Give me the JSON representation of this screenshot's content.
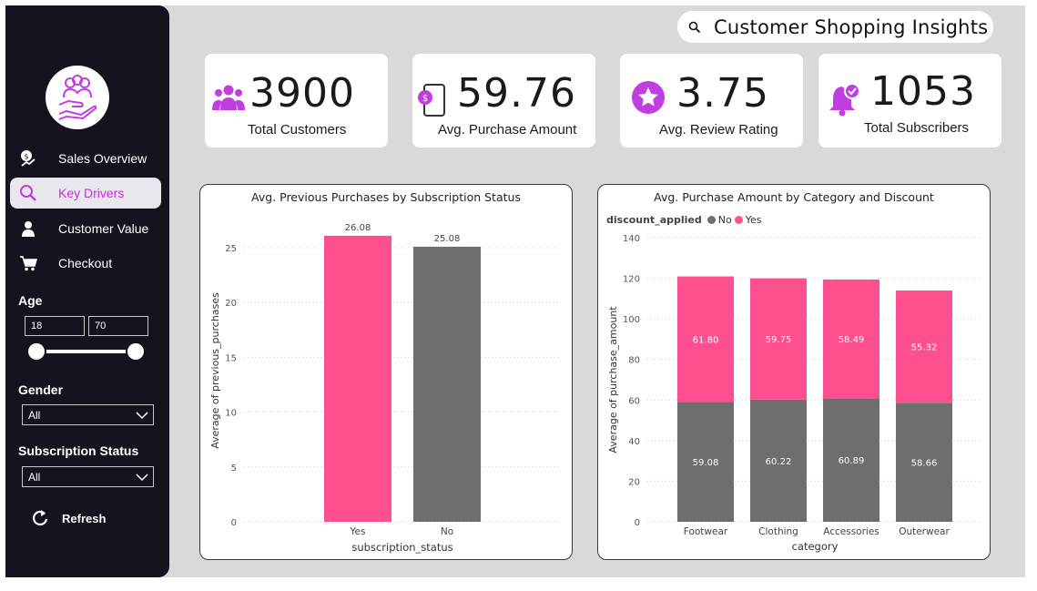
{
  "header": {
    "title": "Customer Shopping Insights"
  },
  "sidebar": {
    "nav": [
      {
        "label": "Sales Overview",
        "icon": "sales-icon",
        "active": false
      },
      {
        "label": "Key Drivers",
        "icon": "magnifier-icon",
        "active": true
      },
      {
        "label": "Customer Value",
        "icon": "person-icon",
        "active": false
      },
      {
        "label": "Checkout",
        "icon": "cart-icon",
        "active": false
      }
    ],
    "age": {
      "label": "Age",
      "min": "18",
      "max": "70"
    },
    "gender": {
      "label": "Gender",
      "value": "All"
    },
    "subscription": {
      "label": "Subscription Status",
      "value": "All"
    },
    "refresh_label": "Refresh"
  },
  "kpis": [
    {
      "value": "3900",
      "label": "Total Customers",
      "icon": "people-icon"
    },
    {
      "value": "59.76",
      "label": "Avg. Purchase Amount",
      "icon": "phone-dollar-icon"
    },
    {
      "value": "3.75",
      "label": "Avg. Review Rating",
      "icon": "star-icon"
    },
    {
      "value": "1053",
      "label": "Total Subscribers",
      "icon": "bell-check-icon"
    }
  ],
  "colors": {
    "accent": "#fe4f8f",
    "gray": "#6e6e6e",
    "icon_purple": "#c03ede",
    "sidebar_bg": "#16131f"
  },
  "chart_data": [
    {
      "type": "bar",
      "title": "Avg. Previous Purchases by Subscription Status",
      "xlabel": "subscription_status",
      "ylabel": "Average of previous_purchases",
      "categories": [
        "Yes",
        "No"
      ],
      "values": [
        26.08,
        25.08
      ],
      "labels": [
        "26.08",
        "25.08"
      ],
      "colors": [
        "#fe4f8f",
        "#6e6e6e"
      ],
      "ylim": [
        0,
        28
      ],
      "yticks": [
        0,
        5,
        10,
        15,
        20,
        25
      ],
      "grid": true
    },
    {
      "type": "bar",
      "stacked": true,
      "title": "Avg. Purchase Amount by Category and Discount",
      "xlabel": "category",
      "ylabel": "Average of purchase_amount",
      "legend_title": "discount_applied",
      "categories": [
        "Footwear",
        "Clothing",
        "Accessories",
        "Outerwear"
      ],
      "series": [
        {
          "name": "No",
          "color": "#6e6e6e",
          "values": [
            59.08,
            60.22,
            60.89,
            58.66
          ],
          "labels": [
            "59.08",
            "60.22",
            "60.89",
            "58.66"
          ]
        },
        {
          "name": "Yes",
          "color": "#fe4f8f",
          "values": [
            61.8,
            59.75,
            58.49,
            55.32
          ],
          "labels": [
            "61.80",
            "59.75",
            "58.49",
            "55.32"
          ]
        }
      ],
      "ylim": [
        0,
        140
      ],
      "yticks": [
        0,
        20,
        40,
        60,
        80,
        100,
        120,
        140
      ],
      "grid": true,
      "legend_position": "top-left"
    }
  ]
}
